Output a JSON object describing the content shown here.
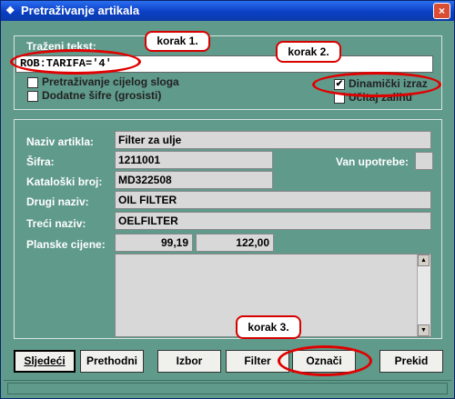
{
  "window": {
    "title": "Pretraživanje artikala",
    "close_glyph": "×",
    "app_icon": "app-icon"
  },
  "search": {
    "label": "Traženi tekst:",
    "value": "ROB:TARIFA='4'",
    "options": [
      {
        "label": "Pretraživanje cijelog sloga",
        "checked": false
      },
      {
        "label": "Dodatne šifre (grosisti)",
        "checked": false
      },
      {
        "label": "Dinamički izraz",
        "checked": true
      },
      {
        "label": "Učitaj zalihu",
        "checked": false
      }
    ]
  },
  "article": {
    "naziv_label": "Naziv artikla:",
    "naziv_value": "Filter za ulje",
    "sifra_label": "Šifra:",
    "sifra_value": "1211001",
    "van_label": "Van upotrebe:",
    "van_value": "",
    "kat_label": "Kataloški broj:",
    "kat_value": "MD322508",
    "drugi_label": "Drugi naziv:",
    "drugi_value": "OIL FILTER",
    "treci_label": "Treći naziv:",
    "treci_value": "OELFILTER",
    "cijene_label": "Planske cijene:",
    "cijena1": "99,19",
    "cijena2": "122,00",
    "memo": ""
  },
  "buttons": {
    "sljedeci": "Sljedeći",
    "prethodni": "Prethodni",
    "izbor": "Izbor",
    "filter": "Filter",
    "oznaci": "Označi",
    "prekid": "Prekid"
  },
  "annotations": {
    "korak1": "korak 1.",
    "korak2": "korak 2.",
    "korak3": "korak 3."
  },
  "colors": {
    "window_bg": "#5f9a8a",
    "callout_border": "#d60000",
    "titlebar": "#0b3fc4"
  }
}
